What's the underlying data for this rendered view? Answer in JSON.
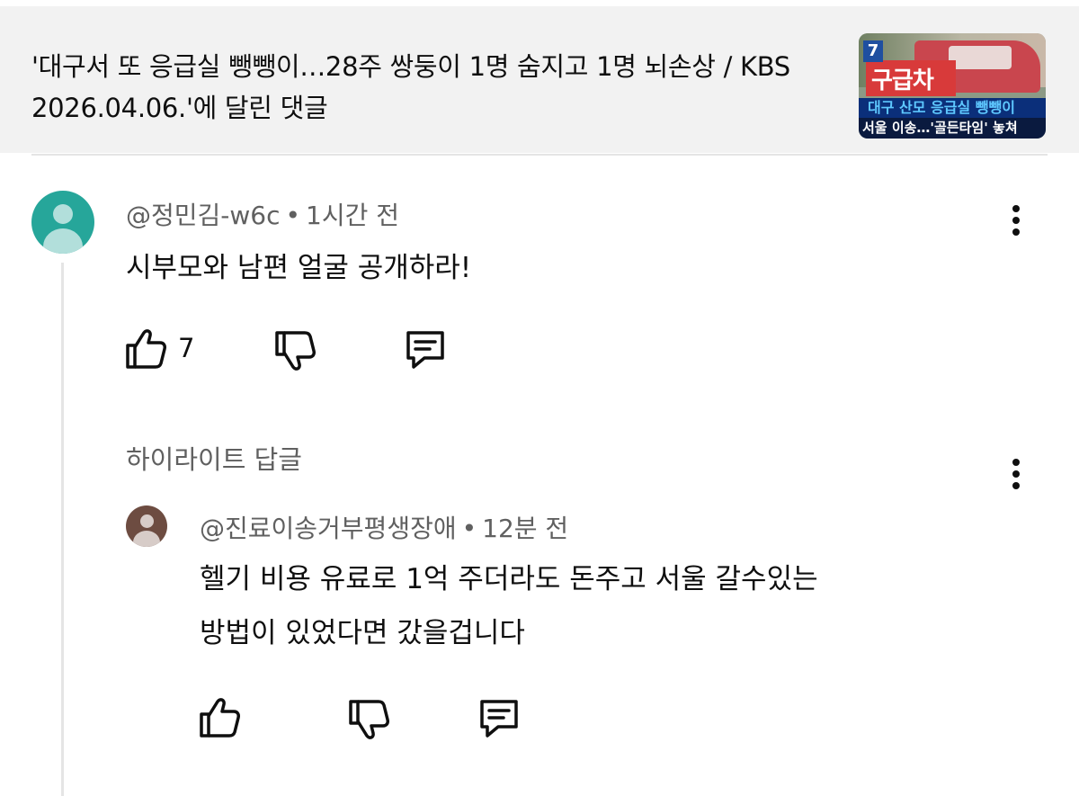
{
  "header": {
    "title": "'대구서 또 응급실 뺑뺑이…28주 쌍둥이 1명 숨지고 1명 뇌손상 / KBS 2026.04.06.'에 달린 댓글",
    "thumbnail": {
      "channel_badge": "7",
      "red_sign_text": "구급차",
      "caption_line1": "대구 산모 응급실 뺑뺑이",
      "caption_line2": "서울 이송…'골든타임' 놓쳐"
    }
  },
  "comment": {
    "author": "@정민김-w6c",
    "time": "1시간 전",
    "separator": "•",
    "text": "시부모와 남편  얼굴 공개하라!",
    "like_count": "7",
    "avatar_color": "#26a69a"
  },
  "highlighted_reply_label": "하이라이트 답글",
  "reply": {
    "author": "@진료이송거부평생장애",
    "time": "12분 전",
    "separator": "•",
    "text_line1": "헬기 비용 유료로 1억 주더라도  돈주고 서울 갈수있는",
    "text_line2": "방법이 있었다면 갔을겁니다",
    "avatar_color": "#6d4c41"
  },
  "icons": [
    "like-icon",
    "dislike-icon",
    "reply-icon",
    "more-vert-icon"
  ]
}
